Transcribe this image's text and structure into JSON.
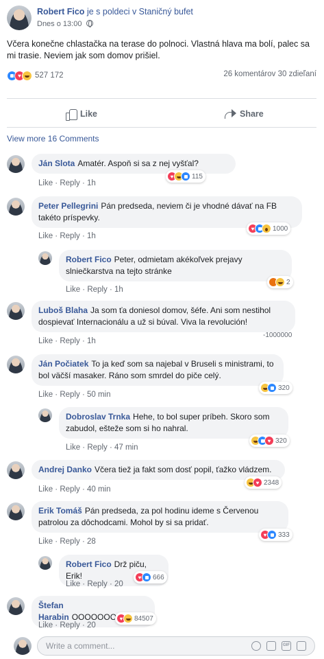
{
  "post": {
    "author": "Robert Fico",
    "author_extra": "je s poldeci v Staničný bufet",
    "time": "Dnes o 13:00",
    "text": "Včera konečne chlastačka na terase do polnoci. Vlastná hlava ma bolí, palec sa mi trasie. Neviem jak som domov prišiel.",
    "reaction_count": "527 172",
    "comments_shares": "26 komentárov 30 zdieľaní"
  },
  "actions": {
    "like": "Like",
    "share": "Share"
  },
  "view_more": "View more 16 Comments",
  "comment_actions": {
    "like": "Like",
    "reply": "Reply"
  },
  "comments": [
    {
      "name": "Ján Slota",
      "text": "Amatér. Aspoň si sa z nej vyšťal?",
      "time": "1h",
      "reactions": [
        "love",
        "haha",
        "like"
      ],
      "count": "115"
    },
    {
      "name": "Peter Pellegrini",
      "text": "Pán predseda, neviem či je vhodné dávať na FB takéto príspevky.",
      "time": "1h",
      "reactions": [
        "love",
        "like",
        "wow"
      ],
      "count": "1000"
    },
    {
      "name": "Robert Fico",
      "text": "Peter, odmietam akékoľvek prejavy slniečkarstva na tejto stránke",
      "time": "1h",
      "reactions": [
        "angry",
        "haha"
      ],
      "count": "2"
    },
    {
      "name": "Luboš Blaha",
      "text": "Ja som ťa doniesol domov, šéfe. Ani som nestihol dospievať Internacionálu a už si búval. Viva la revolución!",
      "time": "1h",
      "reactions": [],
      "count": "-1000000"
    },
    {
      "name": "Ján Počiatek",
      "text": "To ja keď som sa najebal v Bruseli s ministrami, to bol väčší masaker. Ráno som smrdel do piče celý.",
      "time": "50 min",
      "reactions": [
        "haha",
        "like"
      ],
      "count": "320"
    },
    {
      "name": "Dobroslav Trnka",
      "text": "Hehe, to bol super príbeh. Skoro som zabudol, ešteže som si ho nahral.",
      "time": "47 min",
      "reactions": [
        "haha",
        "like",
        "love"
      ],
      "count": "320"
    },
    {
      "name": "Andrej Danko",
      "text": "Včera tiež ja fakt som dosť popil, ťažko vládzem.",
      "time": "40 min",
      "reactions": [
        "haha",
        "love"
      ],
      "count": "2348"
    },
    {
      "name": "Erik Tomáš",
      "text": "Pán predseda, za pol hodinu ideme s Červenou patrolou za dôchodcami. Mohol by si sa pridať.",
      "time": "28",
      "reactions": [
        "love",
        "like"
      ],
      "count": "333"
    },
    {
      "name": "Robert Fico",
      "text": "Drž piču, Erik!",
      "time": "20",
      "reactions": [
        "love",
        "like"
      ],
      "count": "666"
    },
    {
      "name": "Štefan Harabin",
      "text": "OOOOOOOO",
      "time": "20",
      "reactions": [
        "love",
        "haha"
      ],
      "count": "84507"
    }
  ],
  "write_placeholder": "Write a comment...",
  "icons": [
    "globe-icon",
    "like-icon",
    "share-icon",
    "emoji-icon",
    "camera-icon",
    "gif-icon",
    "sticker-icon"
  ],
  "colors": {
    "link": "#385898",
    "bubble": "#f2f3f5",
    "like": "#2d88ff",
    "love": "#f33e58",
    "haha": "#f7c440",
    "angry": "#e9710f"
  }
}
